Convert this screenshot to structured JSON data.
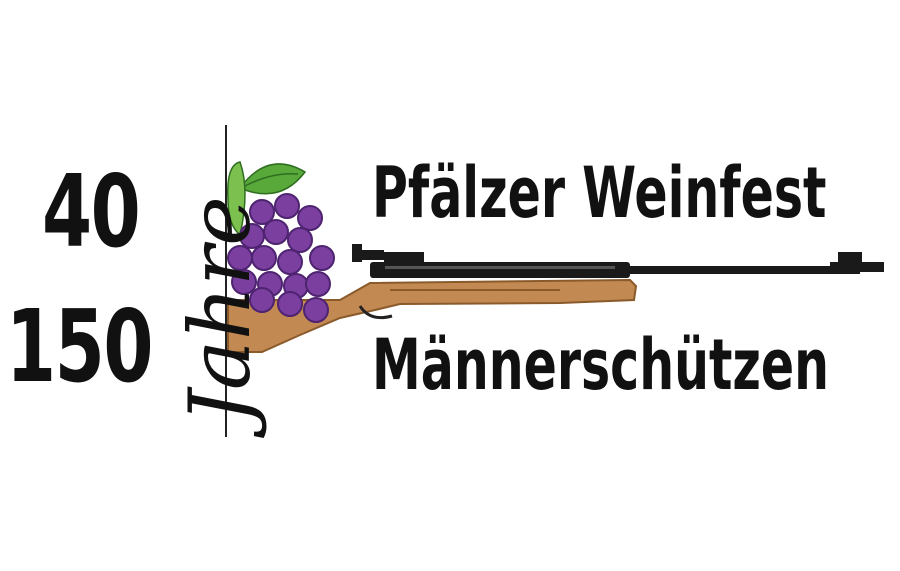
{
  "logo": {
    "years_short": "40",
    "years_long": "150",
    "jahre": "Jahre",
    "title_line1": "Pfälzer Weinfest",
    "title_line2": "Männerschützen"
  },
  "colors": {
    "text": "#111111",
    "grape": "#7b3fa0",
    "grape_dark": "#4e2370",
    "leaf": "#58a83a",
    "stock": "#c28a52",
    "metal": "#1a1a1a"
  },
  "icons": [
    "grapes-icon",
    "leaf-icon",
    "air-rifle-icon"
  ]
}
